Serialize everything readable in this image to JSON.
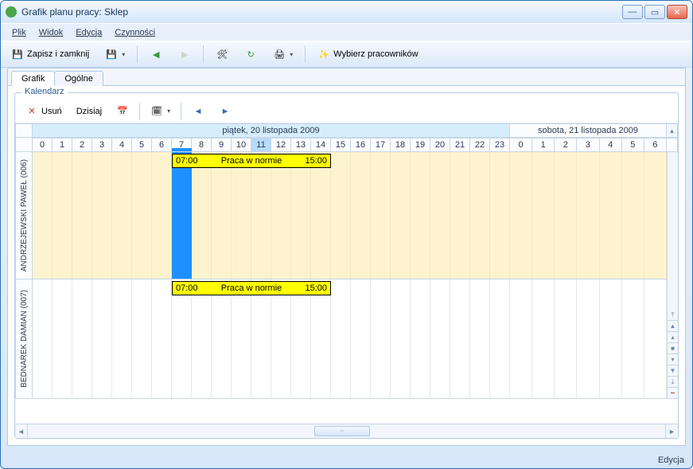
{
  "window": {
    "title": "Grafik planu pracy: Sklep"
  },
  "menu": {
    "file": "Plik",
    "view": "Widok",
    "edit": "Edycja",
    "actions": "Czynności"
  },
  "toolbar": {
    "save_close": "Zapisz i zamknij",
    "select_employees": "Wybierz pracowników"
  },
  "tabs": {
    "grafik": "Grafik",
    "ogolne": "Ogólne"
  },
  "calendar": {
    "group_label": "Kalendarz",
    "delete": "Usuń",
    "today": "Dzisiaj",
    "days": {
      "friday": "piątek, 20 listopada 2009",
      "saturday": "sobota, 21 listopada 2009"
    },
    "hours_fri": [
      "0",
      "1",
      "2",
      "3",
      "4",
      "5",
      "6",
      "7",
      "8",
      "9",
      "10",
      "11",
      "12",
      "13",
      "14",
      "15",
      "16",
      "17",
      "18",
      "19",
      "20",
      "21",
      "22",
      "23"
    ],
    "hours_sat": [
      "0",
      "1",
      "2",
      "3",
      "4",
      "5",
      "6"
    ],
    "current_hour_index": 11,
    "employees": [
      {
        "name": "ANDRZEJEWSKI PAWEŁ (006)",
        "event": {
          "start": "07:00",
          "end": "15:00",
          "label": "Praca w normie"
        }
      },
      {
        "name": "BEDNAREK DAMIAN (007)",
        "event": {
          "start": "07:00",
          "end": "15:00",
          "label": "Praca w normie"
        }
      }
    ]
  },
  "status": {
    "mode": "Edycja"
  }
}
